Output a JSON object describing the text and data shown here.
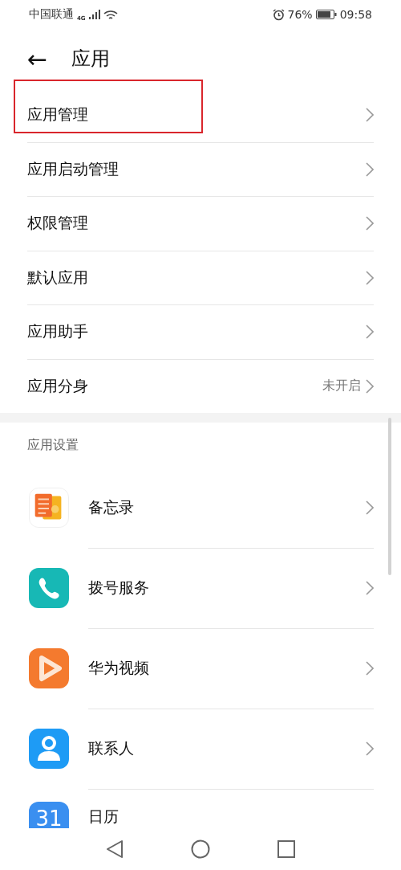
{
  "status_bar": {
    "carrier": "中国联通",
    "network": "4G",
    "battery": "76%",
    "time": "09:58"
  },
  "header": {
    "back": "←",
    "title": "应用"
  },
  "menu_items": [
    {
      "label": "应用管理",
      "highlighted": true
    },
    {
      "label": "应用启动管理",
      "highlighted": false
    },
    {
      "label": "权限管理",
      "highlighted": false
    },
    {
      "label": "默认应用",
      "highlighted": false
    },
    {
      "label": "应用助手",
      "highlighted": false
    },
    {
      "label": "应用分身",
      "highlighted": false,
      "value": "未开启"
    }
  ],
  "section_title": "应用设置",
  "apps": [
    {
      "name": "备忘录",
      "kind": "notes"
    },
    {
      "name": "拨号服务",
      "kind": "phone"
    },
    {
      "name": "华为视频",
      "kind": "video"
    },
    {
      "name": "联系人",
      "kind": "contacts"
    },
    {
      "name": "日历",
      "kind": "calendar",
      "icon_text": "31"
    }
  ]
}
